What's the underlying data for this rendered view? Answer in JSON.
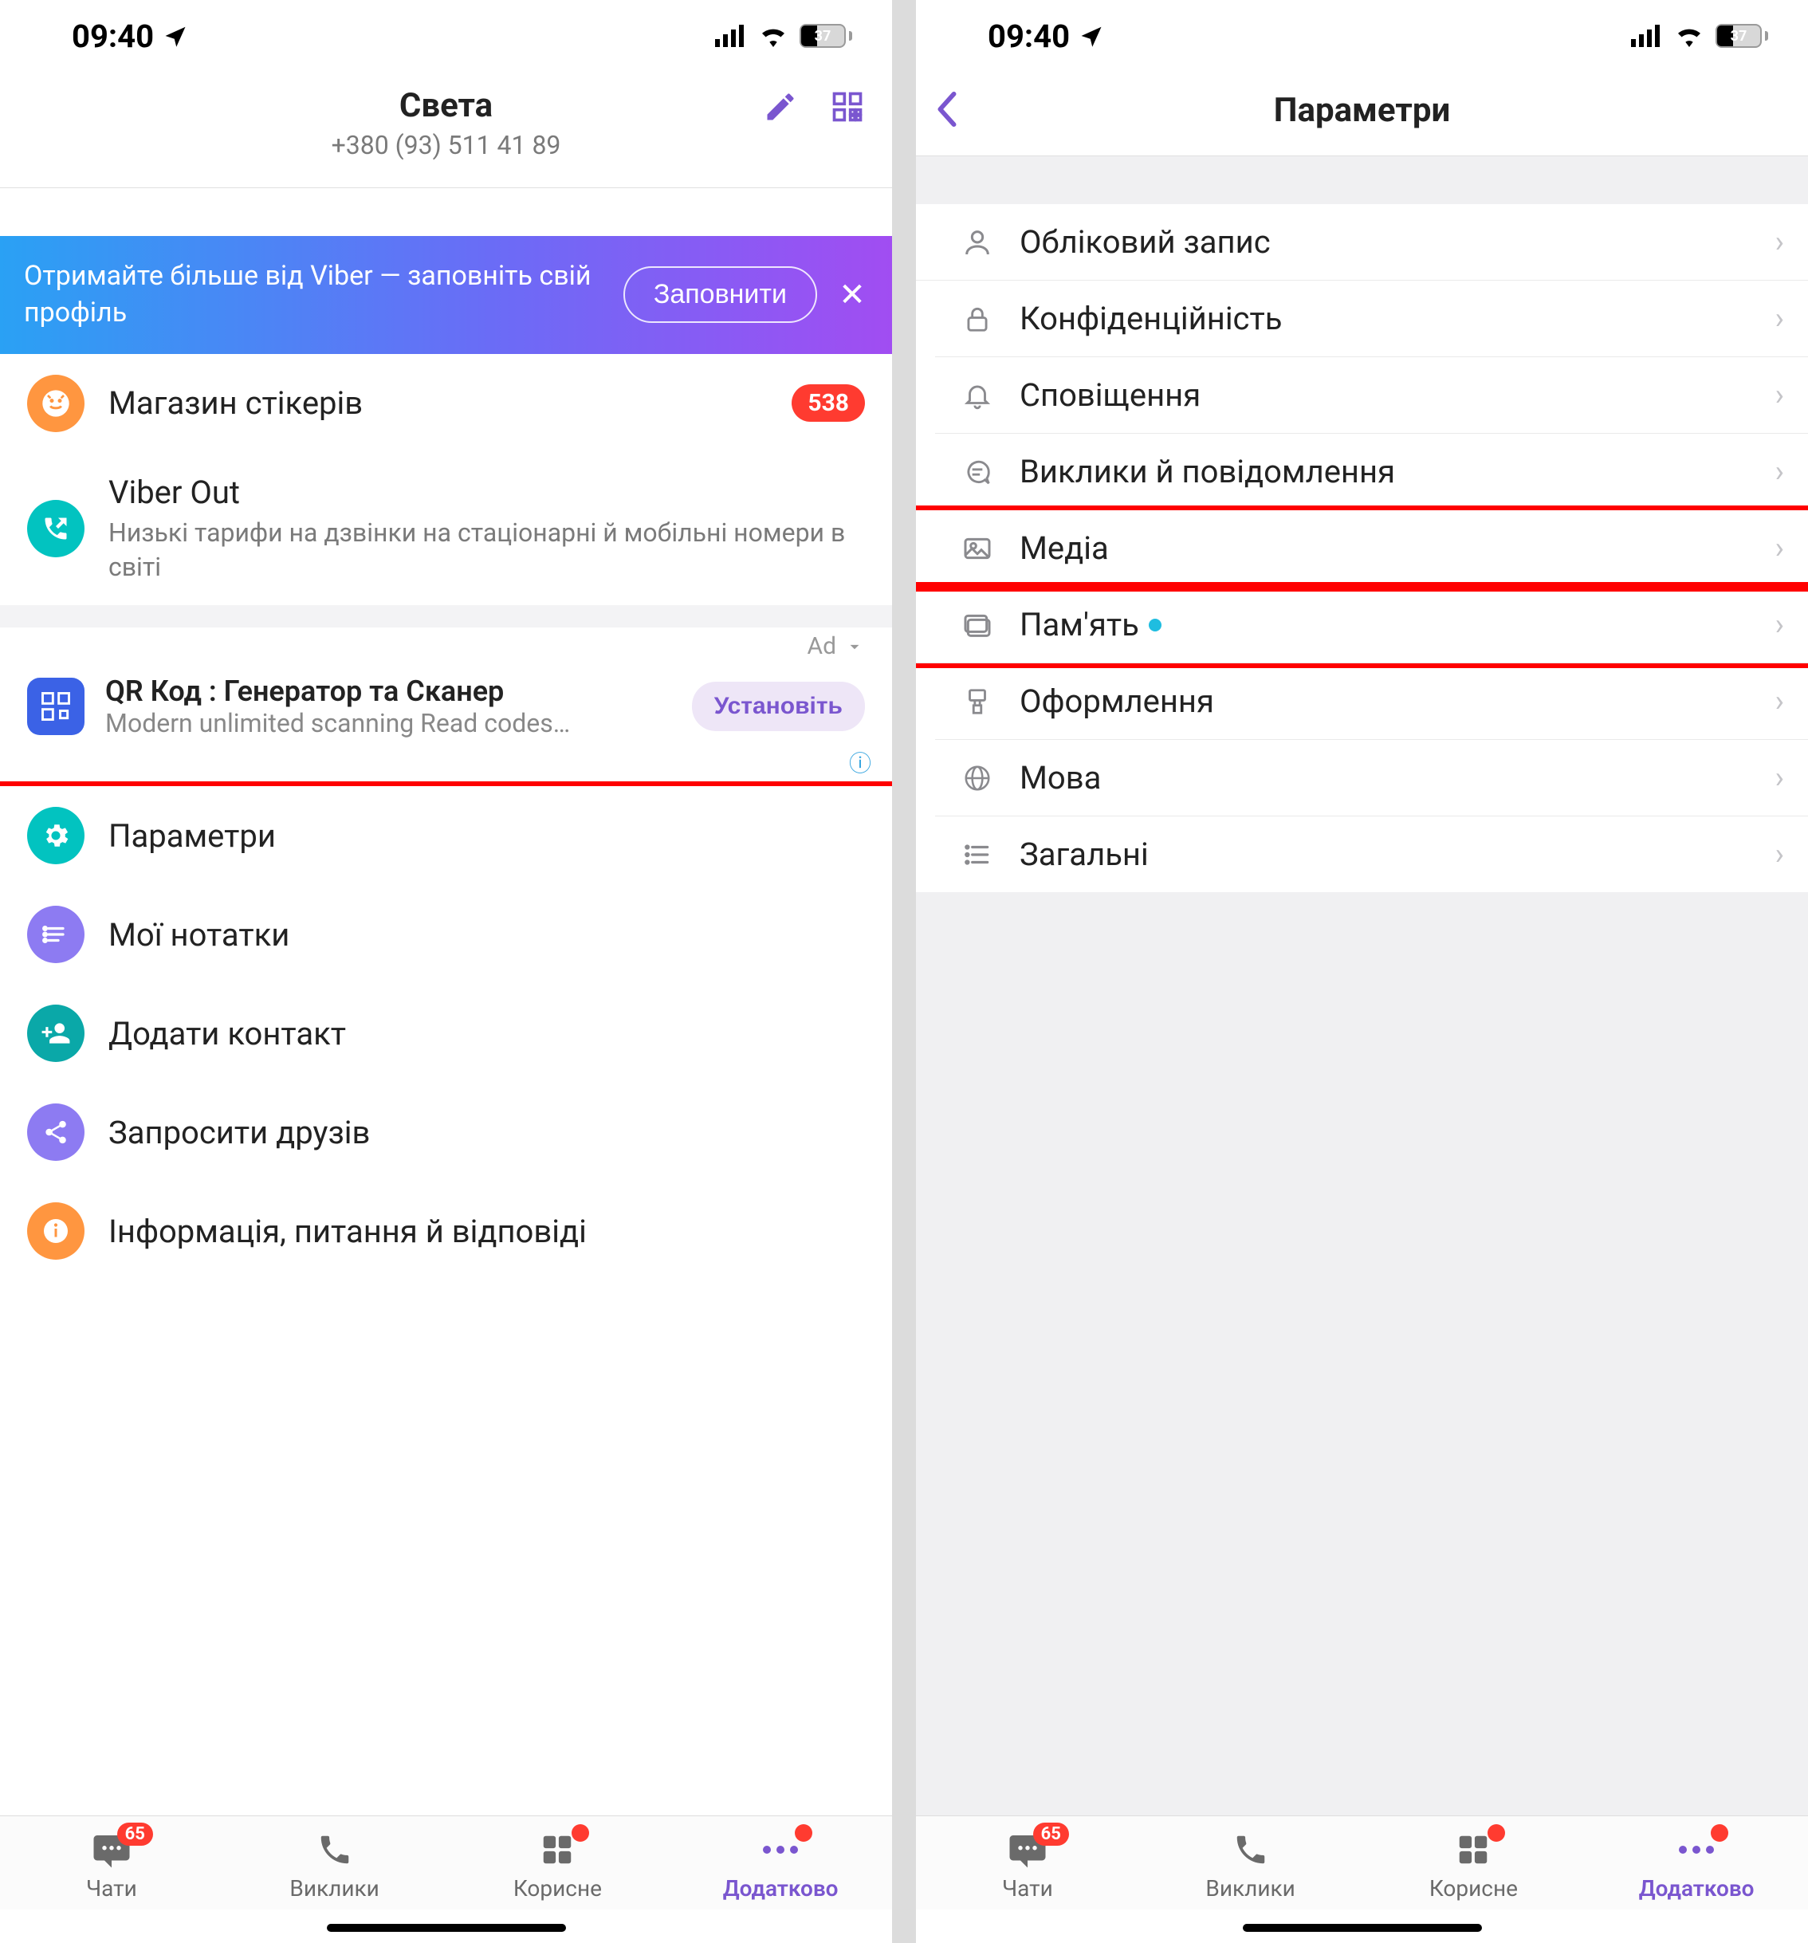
{
  "status": {
    "time": "09:40",
    "battery": "37"
  },
  "left": {
    "profile": {
      "name": "Света",
      "phone": "+380 (93) 511 41 89"
    },
    "banner": {
      "text": "Отримайте більше від Viber — заповніть свій профіль",
      "button": "Заповнити"
    },
    "stickers": {
      "label": "Магазин стікерів",
      "badge": "538"
    },
    "viberout": {
      "label": "Viber Out",
      "sub": "Низькі тарифи на дзвінки на стаціонарні й мобільні номери в світі"
    },
    "ad": {
      "tag": "Ad",
      "title": "QR Код : Генератор та Сканер",
      "sub": "Modern unlimited scanning Read codes…",
      "button": "Установіть"
    },
    "items": {
      "settings": "Параметри",
      "notes": "Мої нотатки",
      "addcontact": "Додати контакт",
      "invite": "Запросити друзів",
      "info": "Інформація, питання й відповіді"
    }
  },
  "right": {
    "title": "Параметри",
    "rows": {
      "account": "Обліковий запис",
      "privacy": "Конфіденційність",
      "notifications": "Сповіщення",
      "calls": "Виклики й повідомлення",
      "media": "Медіа",
      "storage": "Пам'ять",
      "appearance": "Оформлення",
      "language": "Мова",
      "general": "Загальні"
    }
  },
  "tabs": {
    "chats": {
      "label": "Чати",
      "badge": "65"
    },
    "calls": {
      "label": "Виклики"
    },
    "useful": {
      "label": "Корисне"
    },
    "more": {
      "label": "Додатково"
    }
  }
}
